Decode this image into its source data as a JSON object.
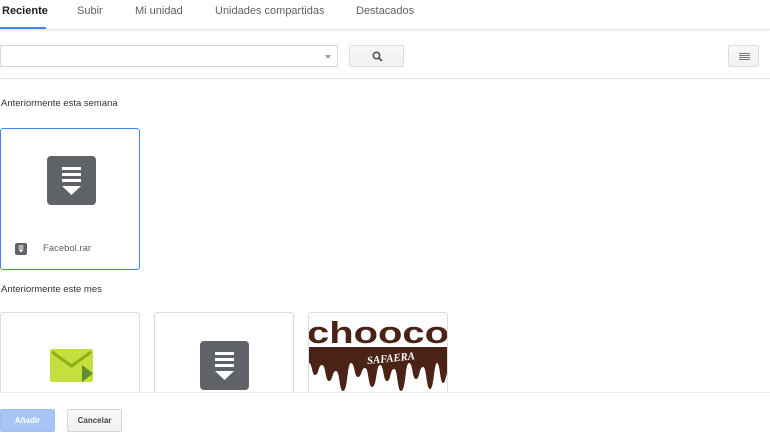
{
  "tabs": [
    {
      "label": "Reciente",
      "active": true
    },
    {
      "label": "Subir",
      "active": false
    },
    {
      "label": "Mi unidad",
      "active": false
    },
    {
      "label": "Unidades compartidas",
      "active": false
    },
    {
      "label": "Destacados",
      "active": false
    }
  ],
  "toolbar": {
    "search_value": "",
    "search_icon": "search-icon",
    "view_icon": "list-view-icon"
  },
  "sections": [
    {
      "title": "Anteriormente esta semana",
      "files": [
        {
          "name": "Facebol.rar",
          "type": "archive",
          "icon": "archive-icon",
          "selected": true
        }
      ]
    },
    {
      "title": "Anteriormente este mes",
      "files": [
        {
          "name": "",
          "type": "email",
          "icon": "email-icon",
          "selected": false
        },
        {
          "name": "",
          "type": "archive",
          "icon": "archive-icon",
          "selected": false
        },
        {
          "name": "",
          "type": "image",
          "icon": "image-thumbnail",
          "thumbnail_text": "chooco",
          "thumbnail_subtext": "SAFAERA",
          "selected": false
        }
      ]
    }
  ],
  "footer": {
    "add_label": "Añadir",
    "cancel_label": "Cancelar"
  },
  "colors": {
    "accent": "#4285f4",
    "add_button_disabled": "#a8c5f8",
    "archive_icon": "#5f6368",
    "email_icon": "#c6df3f",
    "chocolate": "#4a2316"
  }
}
